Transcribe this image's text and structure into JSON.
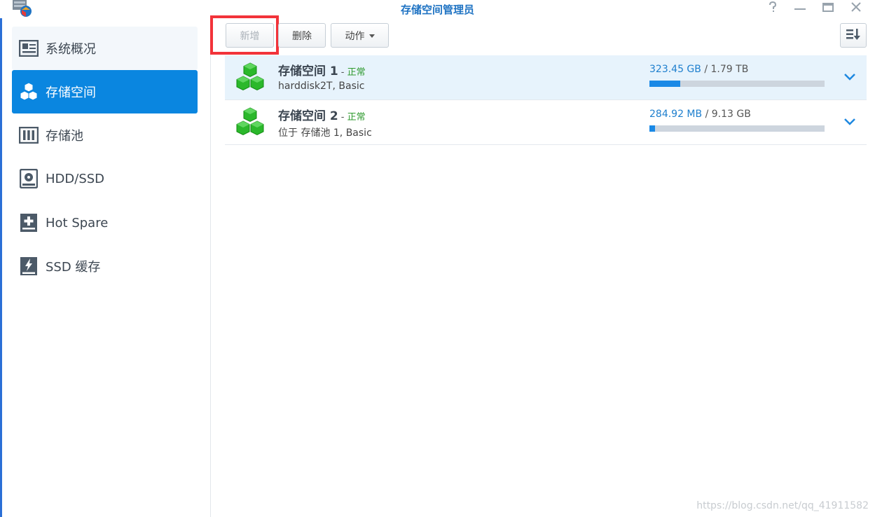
{
  "window": {
    "title": "存储空间管理员"
  },
  "sidebar": {
    "items": [
      {
        "label": "系统概况",
        "icon": "overview-icon"
      },
      {
        "label": "存储空间",
        "icon": "volume-cubes-icon",
        "active": true
      },
      {
        "label": "存储池",
        "icon": "storage-pool-icon"
      },
      {
        "label": "HDD/SSD",
        "icon": "hdd-icon"
      },
      {
        "label": "Hot Spare",
        "icon": "hot-spare-icon"
      },
      {
        "label": "SSD 缓存",
        "icon": "ssd-cache-icon"
      }
    ]
  },
  "toolbar": {
    "create_label": "新增",
    "delete_label": "删除",
    "action_label": "动作"
  },
  "volumes": [
    {
      "name": "存储空间 1",
      "status": "正常",
      "detail": "harddisk2T, Basic",
      "used": "323.45 GB",
      "separator": " / ",
      "total": "1.79 TB",
      "usage_fraction": 0.176
    },
    {
      "name": "存储空间 2",
      "status": "正常",
      "detail": "位于 存储池 1, Basic",
      "used": "284.92 MB",
      "separator": " / ",
      "total": "9.13 GB",
      "usage_fraction": 0.03
    }
  ],
  "watermark": "https://blog.csdn.net/qq_41911582",
  "colors": {
    "accent": "#0a86e0",
    "title": "#1f73c3",
    "status_ok": "#2f9a2f",
    "cube_green": "#2bb82b",
    "highlight": "#f2333a"
  }
}
